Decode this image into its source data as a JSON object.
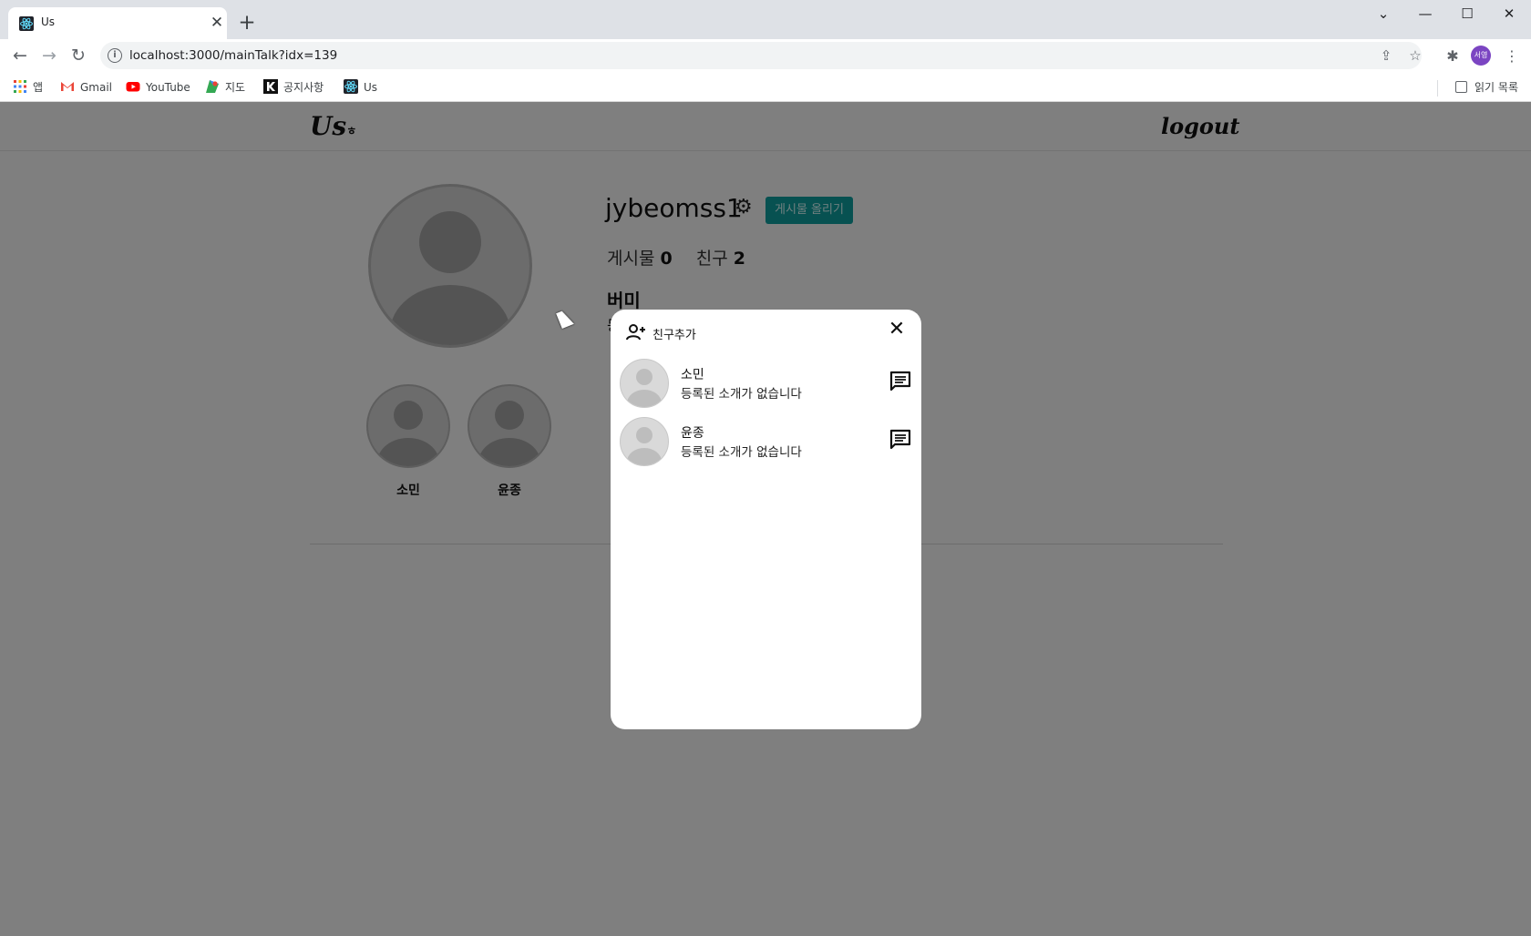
{
  "browser": {
    "tab_title": "Us",
    "url": "localhost:3000/mainTalk?idx=139",
    "profile_initials": "서영",
    "bookmarks": [
      {
        "label": "앱"
      },
      {
        "label": "Gmail"
      },
      {
        "label": "YouTube"
      },
      {
        "label": "지도"
      },
      {
        "label": "공지사항"
      },
      {
        "label": "Us"
      }
    ],
    "reading_list": "읽기 목록"
  },
  "header": {
    "logo": "Us",
    "logo_small": "ㅎ",
    "logout": "logout"
  },
  "profile": {
    "username": "jybeomss1",
    "post_button": "게시물 올리기",
    "posts_label": "게시물",
    "posts_count": "0",
    "friends_label": "친구",
    "friends_count": "2",
    "nickname": "버미",
    "bio_fragment": "등"
  },
  "friends": [
    {
      "name": "소민"
    },
    {
      "name": "윤종"
    }
  ],
  "modal": {
    "title": "친구추가",
    "items": [
      {
        "name": "소민",
        "desc": "등록된 소개가 없습니다"
      },
      {
        "name": "윤종",
        "desc": "등록된 소개가 없습니다"
      }
    ]
  },
  "colors": {
    "accent": "#0fa3a3",
    "overlay": "rgba(0,0,0,0.5)"
  }
}
